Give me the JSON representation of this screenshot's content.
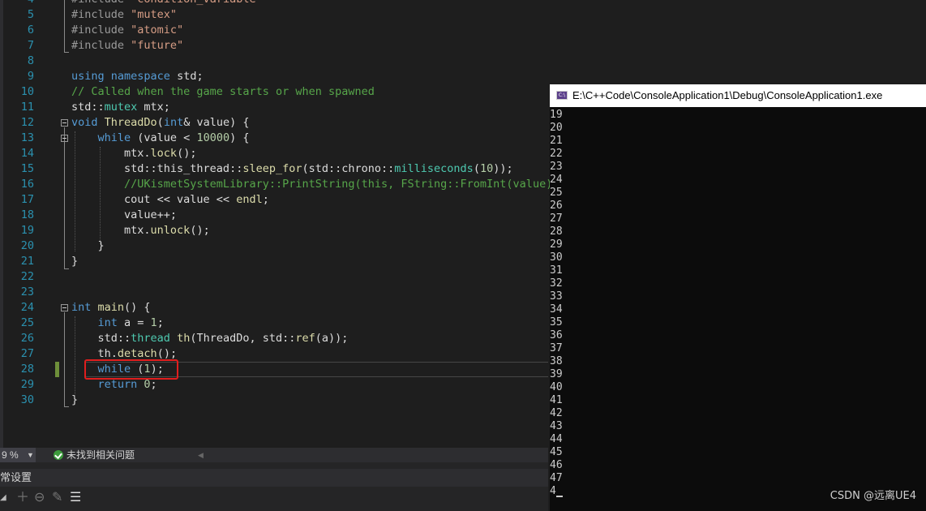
{
  "editor": {
    "lines": [
      {
        "n": "4",
        "tokens": [
          {
            "t": "#include ",
            "c": "pp"
          },
          {
            "t": "\"condition_variable\"",
            "c": "str"
          }
        ]
      },
      {
        "n": "5",
        "tokens": [
          {
            "t": "#include ",
            "c": "pp"
          },
          {
            "t": "\"mutex\"",
            "c": "str"
          }
        ]
      },
      {
        "n": "6",
        "tokens": [
          {
            "t": "#include ",
            "c": "pp"
          },
          {
            "t": "\"atomic\"",
            "c": "str"
          }
        ]
      },
      {
        "n": "7",
        "tokens": [
          {
            "t": "#include ",
            "c": "pp"
          },
          {
            "t": "\"future\"",
            "c": "str"
          }
        ]
      },
      {
        "n": "8",
        "tokens": []
      },
      {
        "n": "9",
        "tokens": [
          {
            "t": "using ",
            "c": "kw"
          },
          {
            "t": "namespace ",
            "c": "kw"
          },
          {
            "t": "std;",
            "c": "id"
          }
        ]
      },
      {
        "n": "10",
        "tokens": [
          {
            "t": "// Called when the game starts or when spawned",
            "c": "cm"
          }
        ]
      },
      {
        "n": "11",
        "tokens": [
          {
            "t": "std::",
            "c": "id"
          },
          {
            "t": "mutex",
            "c": "ty"
          },
          {
            "t": " mtx;",
            "c": "id"
          }
        ]
      },
      {
        "n": "12",
        "tokens": [
          {
            "t": "void ",
            "c": "kw"
          },
          {
            "t": "ThreadDo",
            "c": "fn"
          },
          {
            "t": "(",
            "c": "id"
          },
          {
            "t": "int",
            "c": "kw"
          },
          {
            "t": "& value) {",
            "c": "id"
          }
        ]
      },
      {
        "n": "13",
        "tokens": [
          {
            "t": "    while",
            "c": "kw"
          },
          {
            "t": " (value < ",
            "c": "id"
          },
          {
            "t": "10000",
            "c": "num"
          },
          {
            "t": ") {",
            "c": "id"
          }
        ]
      },
      {
        "n": "14",
        "tokens": [
          {
            "t": "        mtx.",
            "c": "id"
          },
          {
            "t": "lock",
            "c": "fn"
          },
          {
            "t": "();",
            "c": "id"
          }
        ]
      },
      {
        "n": "15",
        "tokens": [
          {
            "t": "        std::this_thread::",
            "c": "id"
          },
          {
            "t": "sleep_for",
            "c": "fn"
          },
          {
            "t": "(std::chrono::",
            "c": "id"
          },
          {
            "t": "milliseconds",
            "c": "ty"
          },
          {
            "t": "(",
            "c": "id"
          },
          {
            "t": "10",
            "c": "num"
          },
          {
            "t": "));",
            "c": "id"
          }
        ]
      },
      {
        "n": "16",
        "tokens": [
          {
            "t": "        //UKismetSystemLibrary::PrintString(this, FString::FromInt(value));",
            "c": "cm"
          }
        ]
      },
      {
        "n": "17",
        "tokens": [
          {
            "t": "        cout << value << ",
            "c": "id"
          },
          {
            "t": "endl",
            "c": "fn"
          },
          {
            "t": ";",
            "c": "id"
          }
        ]
      },
      {
        "n": "18",
        "tokens": [
          {
            "t": "        value++;",
            "c": "id"
          }
        ]
      },
      {
        "n": "19",
        "tokens": [
          {
            "t": "        mtx.",
            "c": "id"
          },
          {
            "t": "unlock",
            "c": "fn"
          },
          {
            "t": "();",
            "c": "id"
          }
        ]
      },
      {
        "n": "20",
        "tokens": [
          {
            "t": "    }",
            "c": "id"
          }
        ]
      },
      {
        "n": "21",
        "tokens": [
          {
            "t": "}",
            "c": "id"
          }
        ]
      },
      {
        "n": "22",
        "tokens": []
      },
      {
        "n": "23",
        "tokens": []
      },
      {
        "n": "24",
        "tokens": [
          {
            "t": "int ",
            "c": "kw"
          },
          {
            "t": "main",
            "c": "fn"
          },
          {
            "t": "() {",
            "c": "id"
          }
        ]
      },
      {
        "n": "25",
        "tokens": [
          {
            "t": "    int",
            "c": "kw"
          },
          {
            "t": " a = ",
            "c": "id"
          },
          {
            "t": "1",
            "c": "num"
          },
          {
            "t": ";",
            "c": "id"
          }
        ]
      },
      {
        "n": "26",
        "tokens": [
          {
            "t": "    std::",
            "c": "id"
          },
          {
            "t": "thread",
            "c": "ty"
          },
          {
            "t": " ",
            "c": "id"
          },
          {
            "t": "th",
            "c": "fn"
          },
          {
            "t": "(ThreadDo, std::",
            "c": "id"
          },
          {
            "t": "ref",
            "c": "fn"
          },
          {
            "t": "(a));",
            "c": "id"
          }
        ]
      },
      {
        "n": "27",
        "tokens": [
          {
            "t": "    th.",
            "c": "id"
          },
          {
            "t": "detach",
            "c": "fn"
          },
          {
            "t": "();",
            "c": "id"
          }
        ]
      },
      {
        "n": "28",
        "tokens": [
          {
            "t": "    while",
            "c": "kw"
          },
          {
            "t": " (",
            "c": "id"
          },
          {
            "t": "1",
            "c": "num"
          },
          {
            "t": ");",
            "c": "id"
          }
        ]
      },
      {
        "n": "29",
        "tokens": [
          {
            "t": "    return ",
            "c": "kw"
          },
          {
            "t": "0",
            "c": "num"
          },
          {
            "t": ";",
            "c": "id"
          }
        ]
      },
      {
        "n": "30",
        "tokens": [
          {
            "t": "}",
            "c": "id"
          }
        ]
      }
    ]
  },
  "statusbar": {
    "zoom": "9 %",
    "issues": "未找到相关问题"
  },
  "panel": {
    "title": "常设置"
  },
  "console": {
    "icon_label": "C:\\",
    "title": "E:\\C++Code\\ConsoleApplication1\\Debug\\ConsoleApplication1.exe",
    "output": [
      "19",
      "20",
      "21",
      "22",
      "23",
      "24",
      "25",
      "26",
      "27",
      "28",
      "29",
      "30",
      "31",
      "32",
      "33",
      "34",
      "35",
      "36",
      "37",
      "38",
      "39",
      "40",
      "41",
      "42",
      "43",
      "44",
      "45",
      "46",
      "47",
      "4"
    ]
  },
  "watermark": "CSDN @远离UE4",
  "colors": {
    "editor_bg": "#1e1e1e",
    "keyword": "#569cd6",
    "string": "#d69d85",
    "comment": "#57a64a",
    "highlight_box": "#e01e1e",
    "console_bg": "#0c0c0c"
  }
}
